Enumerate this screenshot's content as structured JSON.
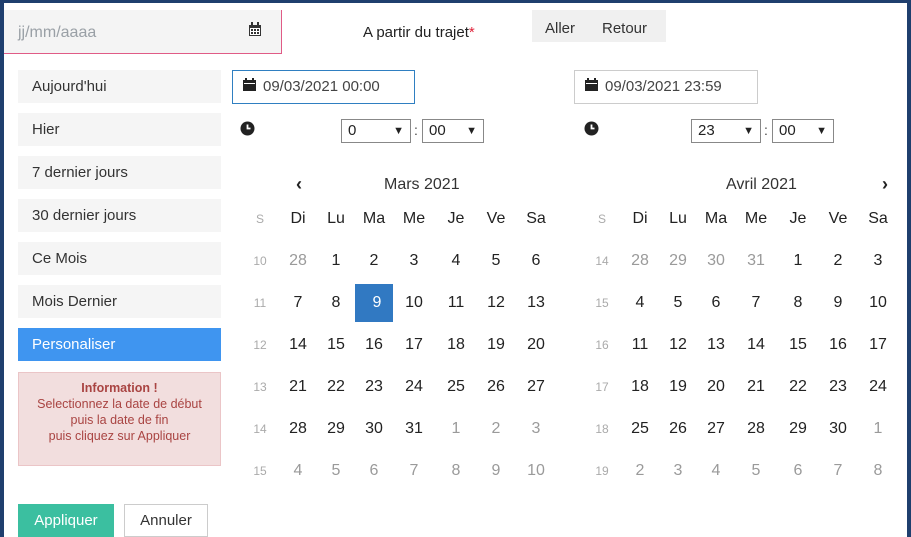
{
  "top": {
    "date_placeholder": "jj/mm/aaaa",
    "trip_label": "A partir du trajet",
    "required_mark": "*",
    "tab_aller": "Aller",
    "tab_retour": "Retour"
  },
  "ranges": [
    {
      "label": "Aujourd'hui",
      "active": false
    },
    {
      "label": "Hier",
      "active": false
    },
    {
      "label": "7 dernier jours",
      "active": false
    },
    {
      "label": "30 dernier jours",
      "active": false
    },
    {
      "label": "Ce Mois",
      "active": false
    },
    {
      "label": "Mois Dernier",
      "active": false
    },
    {
      "label": "Personaliser",
      "active": true
    }
  ],
  "info": {
    "title": "Information !",
    "line1": "Selectionnez la date de début",
    "line2": "puis la date de fin",
    "line3": "puis cliquez sur Appliquer"
  },
  "buttons": {
    "apply": "Appliquer",
    "cancel": "Annuler"
  },
  "start": {
    "datetime": "09/03/2021 00:00",
    "hour": "0",
    "minute": "00"
  },
  "end": {
    "datetime": "09/03/2021 23:59",
    "hour": "23",
    "minute": "00"
  },
  "colon": ":",
  "icons": {
    "nav_prev": "‹",
    "nav_next": "›"
  },
  "weekday_headers": [
    "S",
    "Di",
    "Lu",
    "Ma",
    "Me",
    "Je",
    "Ve",
    "Sa"
  ],
  "left_calendar": {
    "month": "Mars 2021",
    "weeks": [
      {
        "wk": "10",
        "days": [
          "28",
          "1",
          "2",
          "3",
          "4",
          "5",
          "6"
        ],
        "off": [
          true,
          false,
          false,
          false,
          false,
          false,
          false
        ]
      },
      {
        "wk": "11",
        "days": [
          "7",
          "8",
          "9",
          "10",
          "11",
          "12",
          "13"
        ],
        "off": [
          false,
          false,
          false,
          false,
          false,
          false,
          false
        ]
      },
      {
        "wk": "12",
        "days": [
          "14",
          "15",
          "16",
          "17",
          "18",
          "19",
          "20"
        ],
        "off": [
          false,
          false,
          false,
          false,
          false,
          false,
          false
        ]
      },
      {
        "wk": "13",
        "days": [
          "21",
          "22",
          "23",
          "24",
          "25",
          "26",
          "27"
        ],
        "off": [
          false,
          false,
          false,
          false,
          false,
          false,
          false
        ]
      },
      {
        "wk": "14",
        "days": [
          "28",
          "29",
          "30",
          "31",
          "1",
          "2",
          "3"
        ],
        "off": [
          false,
          false,
          false,
          false,
          true,
          true,
          true
        ]
      },
      {
        "wk": "15",
        "days": [
          "4",
          "5",
          "6",
          "7",
          "8",
          "9",
          "10"
        ],
        "off": [
          true,
          true,
          true,
          true,
          true,
          true,
          true
        ]
      }
    ],
    "selected": "9"
  },
  "right_calendar": {
    "month": "Avril 2021",
    "weeks": [
      {
        "wk": "14",
        "days": [
          "28",
          "29",
          "30",
          "31",
          "1",
          "2",
          "3"
        ],
        "off": [
          true,
          true,
          true,
          true,
          false,
          false,
          false
        ]
      },
      {
        "wk": "15",
        "days": [
          "4",
          "5",
          "6",
          "7",
          "8",
          "9",
          "10"
        ],
        "off": [
          false,
          false,
          false,
          false,
          false,
          false,
          false
        ]
      },
      {
        "wk": "16",
        "days": [
          "11",
          "12",
          "13",
          "14",
          "15",
          "16",
          "17"
        ],
        "off": [
          false,
          false,
          false,
          false,
          false,
          false,
          false
        ]
      },
      {
        "wk": "17",
        "days": [
          "18",
          "19",
          "20",
          "21",
          "22",
          "23",
          "24"
        ],
        "off": [
          false,
          false,
          false,
          false,
          false,
          false,
          false
        ]
      },
      {
        "wk": "18",
        "days": [
          "25",
          "26",
          "27",
          "28",
          "29",
          "30",
          "1"
        ],
        "off": [
          false,
          false,
          false,
          false,
          false,
          false,
          true
        ]
      },
      {
        "wk": "19",
        "days": [
          "2",
          "3",
          "4",
          "5",
          "6",
          "7",
          "8"
        ],
        "off": [
          true,
          true,
          true,
          true,
          true,
          true,
          true
        ]
      }
    ]
  }
}
